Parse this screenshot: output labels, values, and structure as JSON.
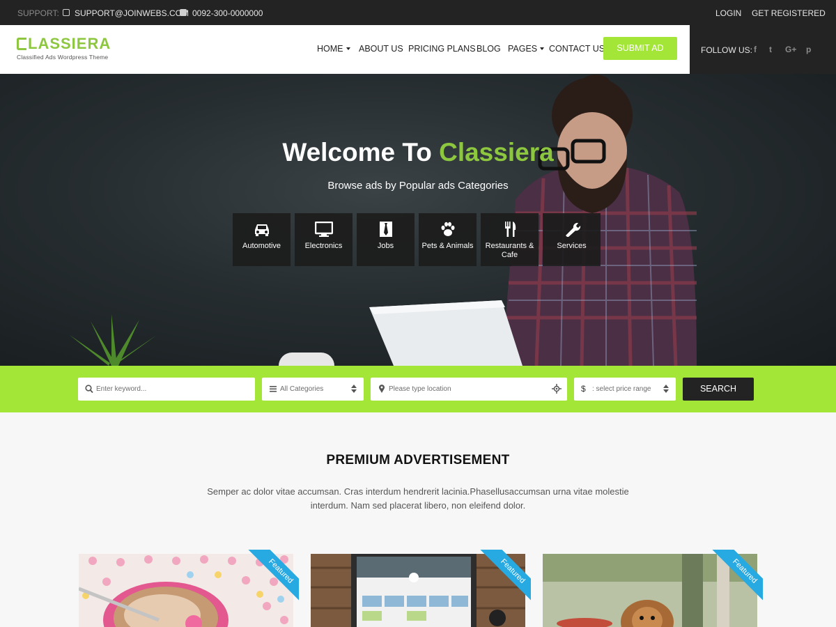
{
  "topbar": {
    "support_label": "SUPPORT:",
    "email": "SUPPORT@JOINWEBS.COM",
    "phone": "0092-300-0000000",
    "login": "LOGIN",
    "register": "GET REGISTERED"
  },
  "brand": {
    "logo_text": "LASSIERA",
    "tagline": "Classified Ads Wordpress Theme",
    "accent_color": "#8dc63f",
    "bar_color": "#a3e637"
  },
  "nav": {
    "items": [
      {
        "label": "HOME",
        "dropdown": true
      },
      {
        "label": "ABOUT US",
        "dropdown": false
      },
      {
        "label": "PRICING PLANS",
        "dropdown": false
      },
      {
        "label": "BLOG",
        "dropdown": false
      },
      {
        "label": "PAGES",
        "dropdown": true
      },
      {
        "label": "CONTACT US",
        "dropdown": false
      }
    ],
    "submit_label": "SUBMIT AD"
  },
  "follow": {
    "label": "FOLLOW US:",
    "icons": [
      "facebook-icon",
      "twitter-icon",
      "google-plus-icon",
      "pinterest-icon"
    ],
    "glyphs": [
      "f",
      "t",
      "G+",
      "p"
    ]
  },
  "hero": {
    "title_prefix": "Welcome To",
    "title_accent": "Classiera",
    "subtitle": "Browse ads by Popular ads Categories",
    "categories": [
      {
        "label": "Automotive",
        "icon": "car-icon"
      },
      {
        "label": "Electronics",
        "icon": "monitor-icon"
      },
      {
        "label": "Jobs",
        "icon": "tie-icon"
      },
      {
        "label": "Pets & Animals",
        "icon": "paw-icon"
      },
      {
        "label": "Restaurants & Cafe",
        "icon": "cutlery-icon"
      },
      {
        "label": "Services",
        "icon": "wrench-icon"
      }
    ]
  },
  "search": {
    "keyword_placeholder": "Enter keyword...",
    "category_value": "All Categories",
    "location_placeholder": "Please type location",
    "price_value": ": select price range",
    "price_prefix": "$",
    "button": "SEARCH"
  },
  "premium": {
    "title": "PREMIUM ADVERTISEMENT",
    "description": "Semper ac dolor vitae accumsan. Cras interdum hendrerit lacinia.Phasellusaccumsan urna vitae molestie interdum. Nam sed placerat libero, non eleifend dolor.",
    "badge": "Featured",
    "badge_color": "#27a9e1",
    "cards": [
      {
        "image": "coffee-cup-photo"
      },
      {
        "image": "laptop-photo"
      },
      {
        "image": "puppy-photo"
      }
    ]
  }
}
